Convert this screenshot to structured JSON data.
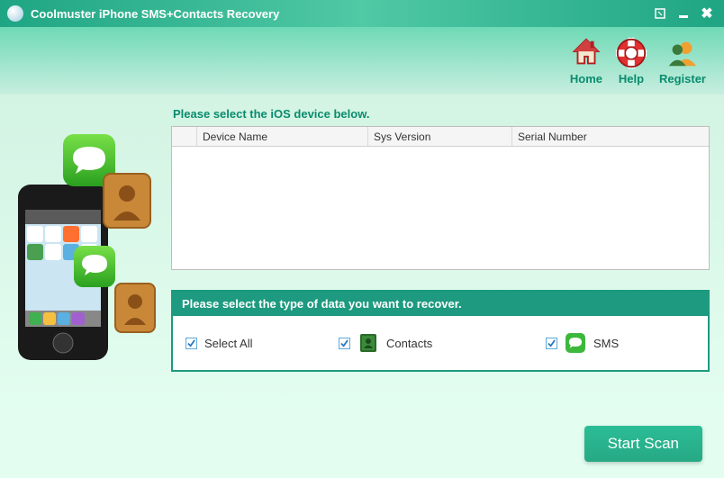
{
  "titlebar": {
    "title": "Coolmuster iPhone SMS+Contacts Recovery"
  },
  "header": {
    "home_label": "Home",
    "help_label": "Help",
    "register_label": "Register"
  },
  "main": {
    "device_prompt": "Please select the iOS device below.",
    "columns": {
      "device_name": "Device Name",
      "sys_version": "Sys Version",
      "serial_number": "Serial Number"
    },
    "type_prompt": "Please select the type of data you want to recover.",
    "types": {
      "select_all": "Select All",
      "contacts": "Contacts",
      "sms": "SMS"
    }
  },
  "footer": {
    "start_scan": "Start Scan"
  }
}
